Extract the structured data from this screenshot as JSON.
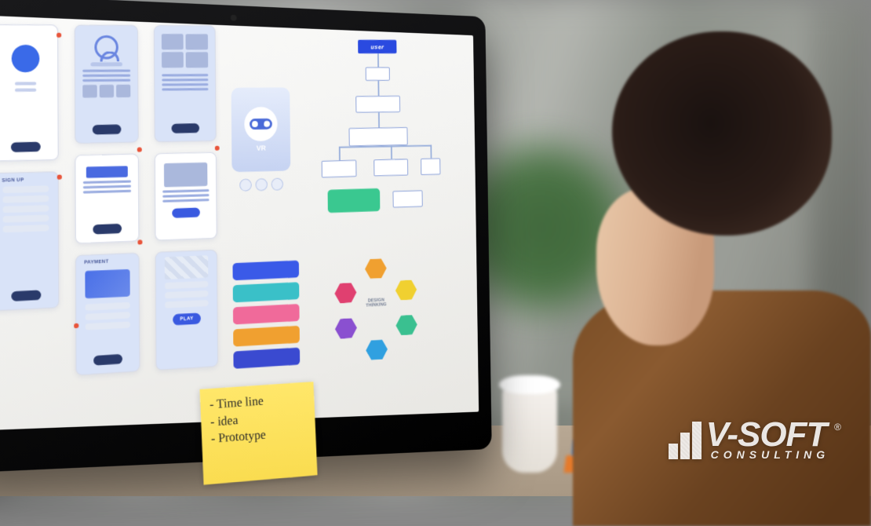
{
  "sticky_note": {
    "line1": "- Time line",
    "line2": "- idea",
    "line3": "- Prototype"
  },
  "logo": {
    "brand": "V-SOFT",
    "tagline": "CONSULTING",
    "registered": "®"
  },
  "screen": {
    "flow_label": "user",
    "mock_signup": "SIGN UP",
    "mock_payment": "PAYMENT",
    "vr_label": "VR",
    "play_label": "PLAY",
    "hex_caption": "DESIGN THINKING",
    "swatch_colors": [
      "#3a5ae8",
      "#3ac0c8",
      "#f06a9a",
      "#f0a030",
      "#3a4ad0"
    ],
    "hex_colors": [
      "#f0a030",
      "#f0d030",
      "#3ac090",
      "#30a0e0",
      "#8a50d0",
      "#e04070"
    ]
  }
}
